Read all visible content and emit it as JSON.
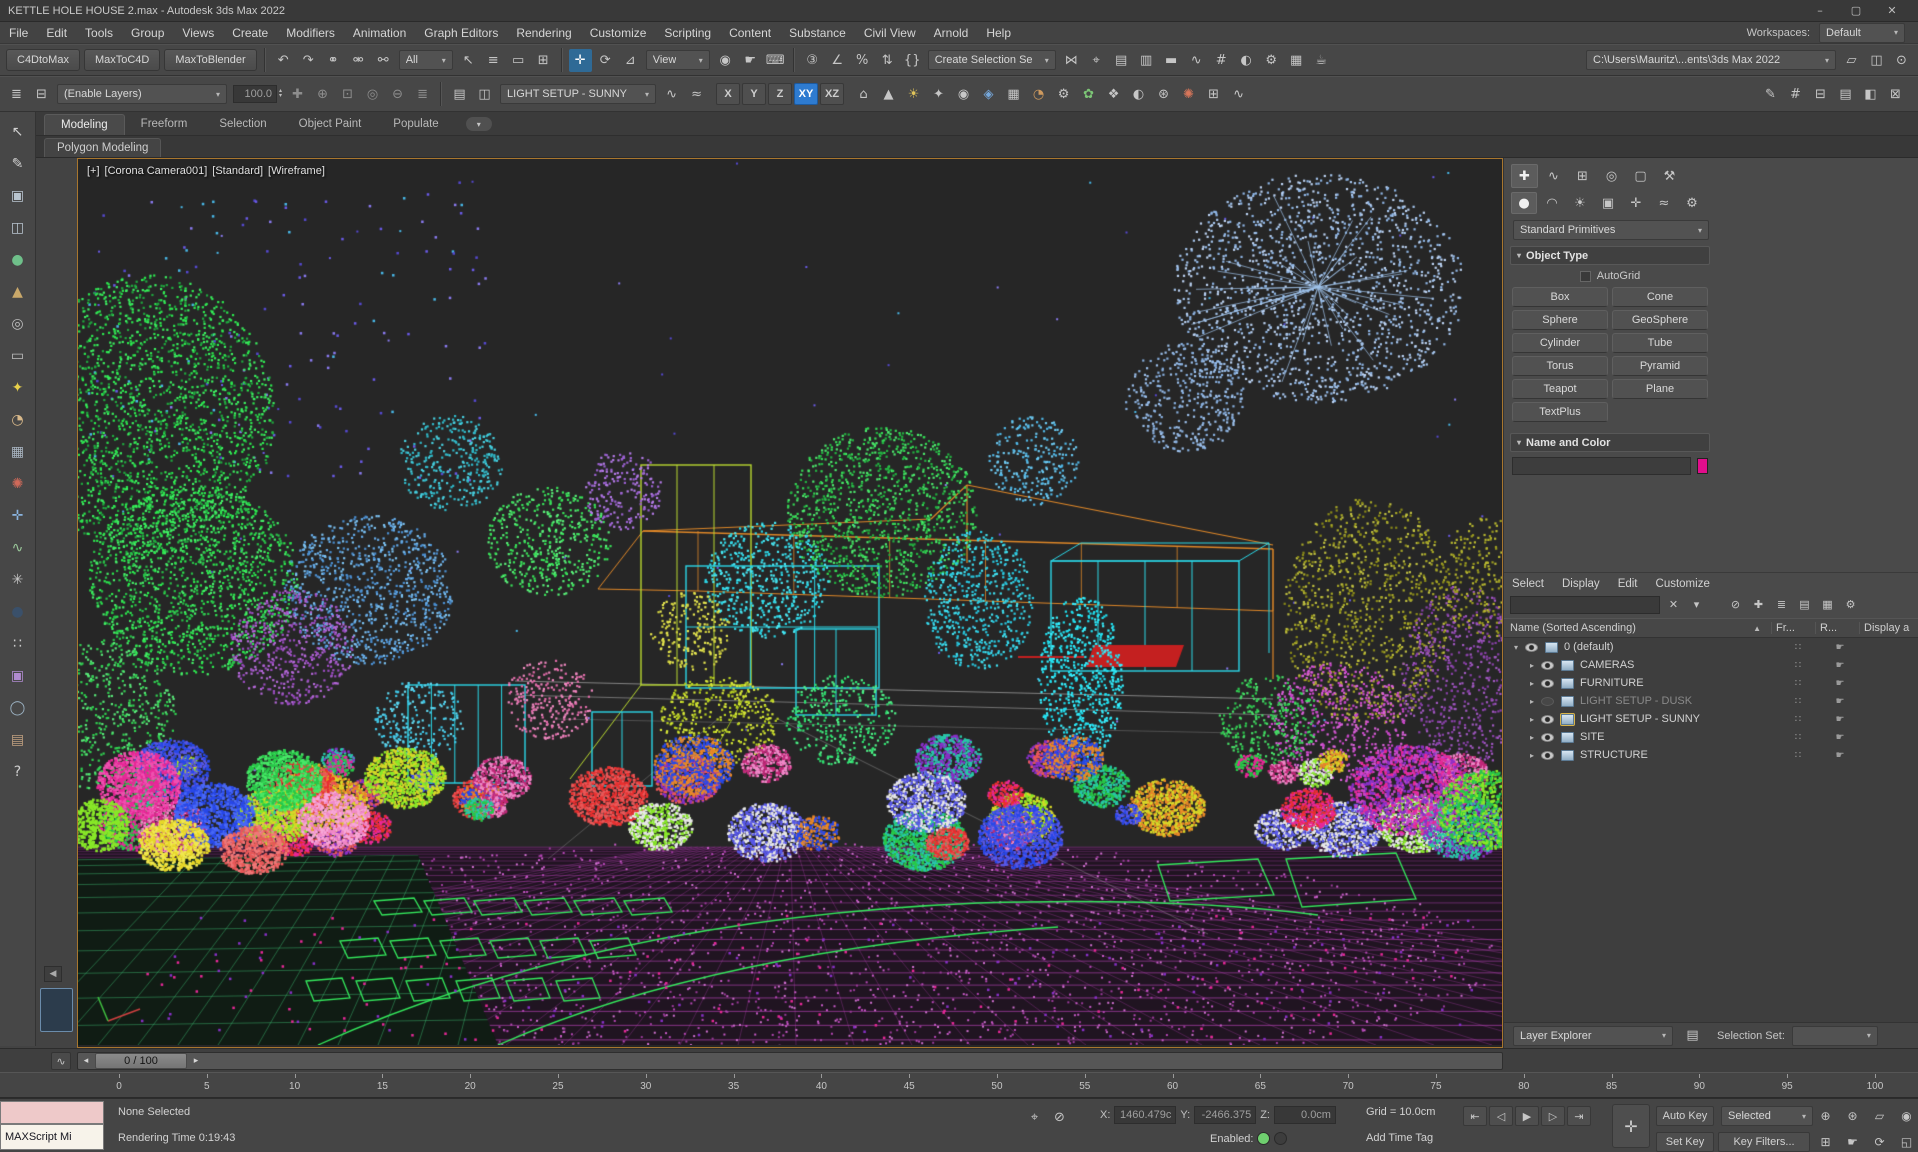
{
  "window": {
    "title": "KETTLE HOLE HOUSE 2.max - Autodesk 3ds Max 2022",
    "buttons": [
      {
        "name": "minimize-button",
        "glyph": "–"
      },
      {
        "name": "maximize-button",
        "glyph": "▢"
      },
      {
        "name": "close-button",
        "glyph": "✕"
      }
    ]
  },
  "menu_bar": {
    "items": [
      "File",
      "Edit",
      "Tools",
      "Group",
      "Views",
      "Create",
      "Modifiers",
      "Animation",
      "Graph Editors",
      "Rendering",
      "Customize",
      "Scripting",
      "Content",
      "Substance",
      "Civil View",
      "Arnold",
      "Help"
    ],
    "workspaces_label": "Workspaces:",
    "workspaces_value": "Default"
  },
  "toolbar_main": {
    "plugin_buttons": [
      "C4DtoMax",
      "MaxToC4D",
      "MaxToBlender"
    ],
    "icons_history": [
      {
        "name": "undo-icon",
        "glyph": "↶"
      },
      {
        "name": "redo-icon",
        "glyph": "↷"
      }
    ],
    "icons_link": [
      {
        "name": "select-and-link-icon",
        "glyph": "⚭"
      },
      {
        "name": "unlink-selection-icon",
        "glyph": "⚮"
      },
      {
        "name": "bind-to-space-warp-icon",
        "glyph": "⚯"
      }
    ],
    "selection_filter": "All",
    "icons_select": [
      {
        "name": "select-object-icon",
        "glyph": "↖"
      },
      {
        "name": "select-by-name-icon",
        "glyph": "≡"
      },
      {
        "name": "rectangular-selection-region-icon",
        "glyph": "▭"
      },
      {
        "name": "window-crossing-toggle-icon",
        "glyph": "⊞"
      }
    ],
    "icons_transform": [
      {
        "name": "select-and-move-icon",
        "glyph": "✛",
        "active": true
      },
      {
        "name": "select-and-rotate-icon",
        "glyph": "⟳"
      },
      {
        "name": "select-and-scale-icon",
        "glyph": "⊿"
      }
    ],
    "coord_system": "View",
    "icons_pivot": [
      {
        "name": "use-pivot-point-center-icon",
        "glyph": "◉"
      }
    ],
    "icons_manipulate": [
      {
        "name": "select-and-manipulate-icon",
        "glyph": "☛"
      },
      {
        "name": "keyboard-shortcut-override-icon",
        "glyph": "⌨"
      }
    ],
    "icons_snap": [
      {
        "name": "snaps-toggle-icon",
        "glyph": "③"
      },
      {
        "name": "angle-snap-icon",
        "glyph": "∠"
      },
      {
        "name": "percent-snap-icon",
        "glyph": "%"
      },
      {
        "name": "spinner-snap-icon",
        "glyph": "⇅"
      }
    ],
    "icons_sets": [
      {
        "name": "edit-named-selection-sets-icon",
        "glyph": "{}"
      }
    ],
    "named_selection_value": "Create Selection Se",
    "icons_tools": [
      {
        "name": "mirror-icon",
        "glyph": "⋈"
      },
      {
        "name": "align-icon",
        "glyph": "⌖"
      },
      {
        "name": "toggle-scene-explorer-icon",
        "glyph": "▤"
      },
      {
        "name": "toggle-layer-explorer-icon",
        "glyph": "▥"
      },
      {
        "name": "toggle-ribbon-icon",
        "glyph": "▬"
      },
      {
        "name": "curve-editor-icon",
        "glyph": "∿"
      },
      {
        "name": "schematic-view-icon",
        "glyph": "#"
      },
      {
        "name": "material-editor-icon",
        "glyph": "◐"
      },
      {
        "name": "render-setup-icon",
        "glyph": "⚙"
      },
      {
        "name": "rendered-frame-window-icon",
        "glyph": "▦"
      },
      {
        "name": "render-production-icon",
        "glyph": "☕"
      }
    ],
    "project_path": "C:\\Users\\Mauritz\\...ents\\3ds Max 2022",
    "icons_right": [
      {
        "name": "open-folder-icon",
        "glyph": "▱"
      },
      {
        "name": "workspace-switch-icon",
        "glyph": "◫"
      },
      {
        "name": "info-center-icon",
        "glyph": "⊙"
      }
    ]
  },
  "toolbar_layers": {
    "icons_left": [
      {
        "name": "layer-explorer-toggle-icon",
        "glyph": "≣"
      },
      {
        "name": "manage-layers-icon",
        "glyph": "⊟"
      }
    ],
    "layer_dropdown": "(Enable Layers)",
    "spinner_value": "100.0",
    "icons_mid": [
      {
        "name": "create-new-layer-icon",
        "glyph": "✚"
      },
      {
        "name": "add-selection-to-layer-icon",
        "glyph": "⊕"
      },
      {
        "name": "select-objects-in-layer-icon",
        "glyph": "⊡"
      },
      {
        "name": "set-current-layer-icon",
        "glyph": "◎"
      },
      {
        "name": "get-layer-from-selection-icon",
        "glyph": "⊖"
      },
      {
        "name": "layer-properties-icon",
        "glyph": "≣"
      }
    ],
    "icons_pre_combo": [
      {
        "name": "isolate-layer-icon",
        "glyph": "▤"
      },
      {
        "name": "layer-states-icon",
        "glyph": "◫"
      }
    ],
    "active_layer": "LIGHT SETUP - SUNNY",
    "icons_after_combo": [
      {
        "name": "light-lister-icon",
        "glyph": "∿"
      },
      {
        "name": "scene-states-icon",
        "glyph": "≈"
      }
    ],
    "axis_buttons": [
      {
        "label": "X"
      },
      {
        "label": "Y"
      },
      {
        "label": "Z"
      },
      {
        "label": "XY",
        "active": true
      },
      {
        "label": "XZ"
      }
    ],
    "icons_objects": [
      {
        "name": "house-tool-icon",
        "glyph": "⌂"
      },
      {
        "name": "pyramid-tool-icon",
        "glyph": "▲"
      },
      {
        "name": "sunlight-tool-icon",
        "glyph": "☀",
        "color": "#e0c45a"
      },
      {
        "name": "star-tool-icon",
        "glyph": "✦"
      },
      {
        "name": "target-tool-icon",
        "glyph": "◉"
      },
      {
        "name": "diamond-tool-icon",
        "glyph": "◈",
        "color": "#76a8dc"
      },
      {
        "name": "grid-tool-icon",
        "glyph": "▦"
      },
      {
        "name": "sphere-tool-icon",
        "glyph": "◔",
        "color": "#cf9a5e"
      },
      {
        "name": "gear-tool-icon",
        "glyph": "⚙"
      },
      {
        "name": "foliage-tool-icon",
        "glyph": "✿",
        "color": "#7cc576"
      },
      {
        "name": "ornament-tool-icon",
        "glyph": "❖"
      },
      {
        "name": "shaded-sphere-tool-icon",
        "glyph": "◐"
      },
      {
        "name": "circle-star-tool-icon",
        "glyph": "⊛"
      },
      {
        "name": "burst-tool-icon",
        "glyph": "✺",
        "color": "#d8765a"
      },
      {
        "name": "grid-plus-tool-icon",
        "glyph": "⊞"
      },
      {
        "name": "curve-tool-icon",
        "glyph": "∿"
      }
    ],
    "icons_right": [
      {
        "name": "annotate-icon",
        "glyph": "✎"
      },
      {
        "name": "measure-icon",
        "glyph": "#"
      },
      {
        "name": "container-icon",
        "glyph": "⊟"
      },
      {
        "name": "scene-list-icon",
        "glyph": "▤"
      },
      {
        "name": "shade-toggle-icon",
        "glyph": "◧"
      },
      {
        "name": "close-toolbar-icon",
        "glyph": "⊠"
      }
    ]
  },
  "ribbon": {
    "tabs": [
      "Modeling",
      "Freeform",
      "Selection",
      "Object Paint",
      "Populate"
    ],
    "active_tab": "Modeling",
    "subtab": "Polygon Modeling",
    "config_icons": [
      {
        "name": "ribbon-display-toggle-icon",
        "glyph": "▾"
      }
    ]
  },
  "left_dock": {
    "icons": [
      {
        "name": "tool-select-icon",
        "glyph": "↖",
        "color": "#cfcfcf"
      },
      {
        "name": "tool-brush-icon",
        "glyph": "✎",
        "color": "#cfcfcf"
      },
      {
        "name": "tool-box-icon",
        "glyph": "▣",
        "color": "#b8c4cf"
      },
      {
        "name": "tool-cylinder-icon",
        "glyph": "◫",
        "color": "#b8c4cf"
      },
      {
        "name": "tool-sphere-icon",
        "glyph": "●",
        "color": "#6fc08a"
      },
      {
        "name": "tool-cone-icon",
        "glyph": "▲",
        "color": "#c9a86a"
      },
      {
        "name": "tool-torus-icon",
        "glyph": "◎",
        "color": "#bfbfbf"
      },
      {
        "name": "tool-plane-icon",
        "glyph": "▭",
        "color": "#bfbfbf"
      },
      {
        "name": "tool-star-icon",
        "glyph": "✦",
        "color": "#e8d04a"
      },
      {
        "name": "tool-shaded-sphere-icon",
        "glyph": "◔",
        "color": "#d9b98a"
      },
      {
        "name": "tool-pattern-icon",
        "glyph": "▦",
        "color": "#a8b4c0"
      },
      {
        "name": "tool-spray-icon",
        "glyph": "✺",
        "color": "#d06a5a"
      },
      {
        "name": "tool-axis-icon",
        "glyph": "✛",
        "color": "#8ab4e0"
      },
      {
        "name": "tool-wave-icon",
        "glyph": "∿",
        "color": "#9ac89a"
      },
      {
        "name": "tool-burst-icon",
        "glyph": "✳",
        "color": "#c9c9c9"
      },
      {
        "name": "tool-dark-sphere-icon",
        "glyph": "●",
        "color": "#3a506a"
      },
      {
        "name": "tool-dots-icon",
        "glyph": "∷",
        "color": "#c9c9c9"
      },
      {
        "name": "tool-image-icon",
        "glyph": "▣",
        "color": "#b08ad0"
      },
      {
        "name": "tool-ring-icon",
        "glyph": "◯",
        "color": "#9ab0c0"
      },
      {
        "name": "tool-stack-icon",
        "glyph": "▤",
        "color": "#c0a080"
      },
      {
        "name": "tool-help-icon",
        "glyph": "?",
        "color": "#cfcfcf"
      }
    ]
  },
  "viewport": {
    "labels": [
      "[+]",
      "[Corona Camera001]",
      "[Standard]",
      "[Wireframe]"
    ],
    "tabs_arrow": "◀"
  },
  "command_panel": {
    "tabs": [
      {
        "name": "create-tab-icon",
        "glyph": "✚",
        "active": true
      },
      {
        "name": "modify-tab-icon",
        "glyph": "∿"
      },
      {
        "name": "hierarchy-tab-icon",
        "glyph": "⊞"
      },
      {
        "name": "motion-tab-icon",
        "glyph": "◎"
      },
      {
        "name": "display-tab-icon",
        "glyph": "▢"
      },
      {
        "name": "utilities-tab-icon",
        "glyph": "⚒"
      }
    ],
    "categories": [
      {
        "name": "geometry-category-icon",
        "glyph": "●",
        "active": true
      },
      {
        "name": "shapes-category-icon",
        "glyph": "◠"
      },
      {
        "name": "lights-category-icon",
        "glyph": "☀"
      },
      {
        "name": "cameras-category-icon",
        "glyph": "▣"
      },
      {
        "name": "helpers-category-icon",
        "glyph": "✛"
      },
      {
        "name": "space-warps-category-icon",
        "glyph": "≈"
      },
      {
        "name": "systems-category-icon",
        "glyph": "⚙"
      }
    ],
    "category_dropdown": "Standard Primitives",
    "object_type": {
      "title": "Object Type",
      "autogrid_label": "AutoGrid",
      "buttons": [
        "Box",
        "Cone",
        "Sphere",
        "GeoSphere",
        "Cylinder",
        "Tube",
        "Torus",
        "Pyramid",
        "Teapot",
        "Plane",
        "TextPlus"
      ]
    },
    "name_color": {
      "title": "Name and Color",
      "color": "#e20d8c"
    }
  },
  "scene_explorer": {
    "menus": [
      "Select",
      "Display",
      "Edit",
      "Customize"
    ],
    "toolbar_icons": [
      {
        "name": "clear-search-icon",
        "glyph": "✕"
      },
      {
        "name": "search-filter-icon",
        "glyph": "▾"
      }
    ],
    "tool_icons_right": [
      {
        "name": "lock-explorer-icon",
        "glyph": "⊘"
      },
      {
        "name": "pick-parent-icon",
        "glyph": "✚"
      },
      {
        "name": "sort-mode-icon",
        "glyph": "≣"
      },
      {
        "name": "display-hierarchy-icon",
        "glyph": "▤"
      },
      {
        "name": "display-objects-icon",
        "glyph": "▦"
      },
      {
        "name": "explorer-settings-icon",
        "glyph": "⚙"
      }
    ],
    "header": {
      "name_column": "Name (Sorted Ascending)",
      "sort_arrow": "▲",
      "columns": [
        "Fr...",
        "R...",
        "Display a"
      ]
    },
    "row_icons": {
      "frozen_glyph": "∷",
      "render_glyph": "☛"
    },
    "rows": [
      {
        "expand": "▾",
        "name": "0 (default)",
        "indent": 0,
        "eye": true
      },
      {
        "expand": "▸",
        "name": "CAMERAS",
        "indent": 1,
        "eye": true
      },
      {
        "expand": "▸",
        "name": "FURNITURE",
        "indent": 1,
        "eye": true
      },
      {
        "expand": "▸",
        "name": "LIGHT SETUP - DUSK",
        "indent": 1,
        "eye": false,
        "dimmed": true
      },
      {
        "expand": "▸",
        "name": "LIGHT SETUP - SUNNY",
        "indent": 1,
        "eye": true,
        "current": true
      },
      {
        "expand": "▸",
        "name": "SITE",
        "indent": 1,
        "eye": true
      },
      {
        "expand": "▸",
        "name": "STRUCTURE",
        "indent": 1,
        "eye": true
      }
    ],
    "footer": {
      "explorer_mode": "Layer Explorer",
      "footer_icon": {
        "name": "explorer-list-icon",
        "glyph": "▤"
      },
      "selection_set_label": "Selection Set:"
    }
  },
  "timeline": {
    "slider_label": "0 / 100",
    "prev_arrow": "◂",
    "next_arrow": "▸",
    "mini_curve_glyph": "∿",
    "ticks": [
      "0",
      "5",
      "10",
      "15",
      "20",
      "25",
      "30",
      "35",
      "40",
      "45",
      "50",
      "55",
      "60",
      "65",
      "70",
      "75",
      "80",
      "85",
      "90",
      "95",
      "100"
    ]
  },
  "status_bar": {
    "maxscript_label": "MAXScript Mi",
    "selection_status": "None Selected",
    "render_time": "Rendering Time 0:19:43",
    "mid_icons": [
      {
        "name": "transform-typein-icon",
        "glyph": "⌖"
      },
      {
        "name": "selection-lock-toggle-icon",
        "glyph": "⊘"
      }
    ],
    "coords": {
      "x_label": "X:",
      "x_value": "1460.479c",
      "y_label": "Y:",
      "y_value": "-2466.375",
      "z_label": "Z:",
      "z_value": "0.0cm"
    },
    "grid_label": "Grid = 10.0cm",
    "enabled_label": "Enabled:",
    "add_time_tag": "Add Time Tag",
    "set_keys_glyph": "✛",
    "auto_key": "Auto Key",
    "set_key": "Set Key",
    "selected_value": "Selected",
    "key_filters": "Key Filters...",
    "playback": [
      {
        "name": "go-to-start-button",
        "glyph": "⇤"
      },
      {
        "name": "previous-frame-button",
        "glyph": "◁"
      },
      {
        "name": "play-button",
        "glyph": "▶"
      },
      {
        "name": "next-frame-button",
        "glyph": "▷"
      },
      {
        "name": "go-to-end-button",
        "glyph": "⇥"
      }
    ],
    "nav_icons_top": [
      {
        "name": "zoom-icon",
        "glyph": "⊕"
      },
      {
        "name": "zoom-all-icon",
        "glyph": "⊛"
      },
      {
        "name": "zoom-extents-icon",
        "glyph": "▱"
      },
      {
        "name": "zoom-region-icon",
        "glyph": "◉"
      }
    ],
    "nav_icons_bottom": [
      {
        "name": "field-of-view-icon",
        "glyph": "⊞"
      },
      {
        "name": "pan-icon",
        "glyph": "☛"
      },
      {
        "name": "orbit-icon",
        "glyph": "⟳"
      },
      {
        "name": "maximize-viewport-icon",
        "glyph": "◱"
      }
    ]
  }
}
